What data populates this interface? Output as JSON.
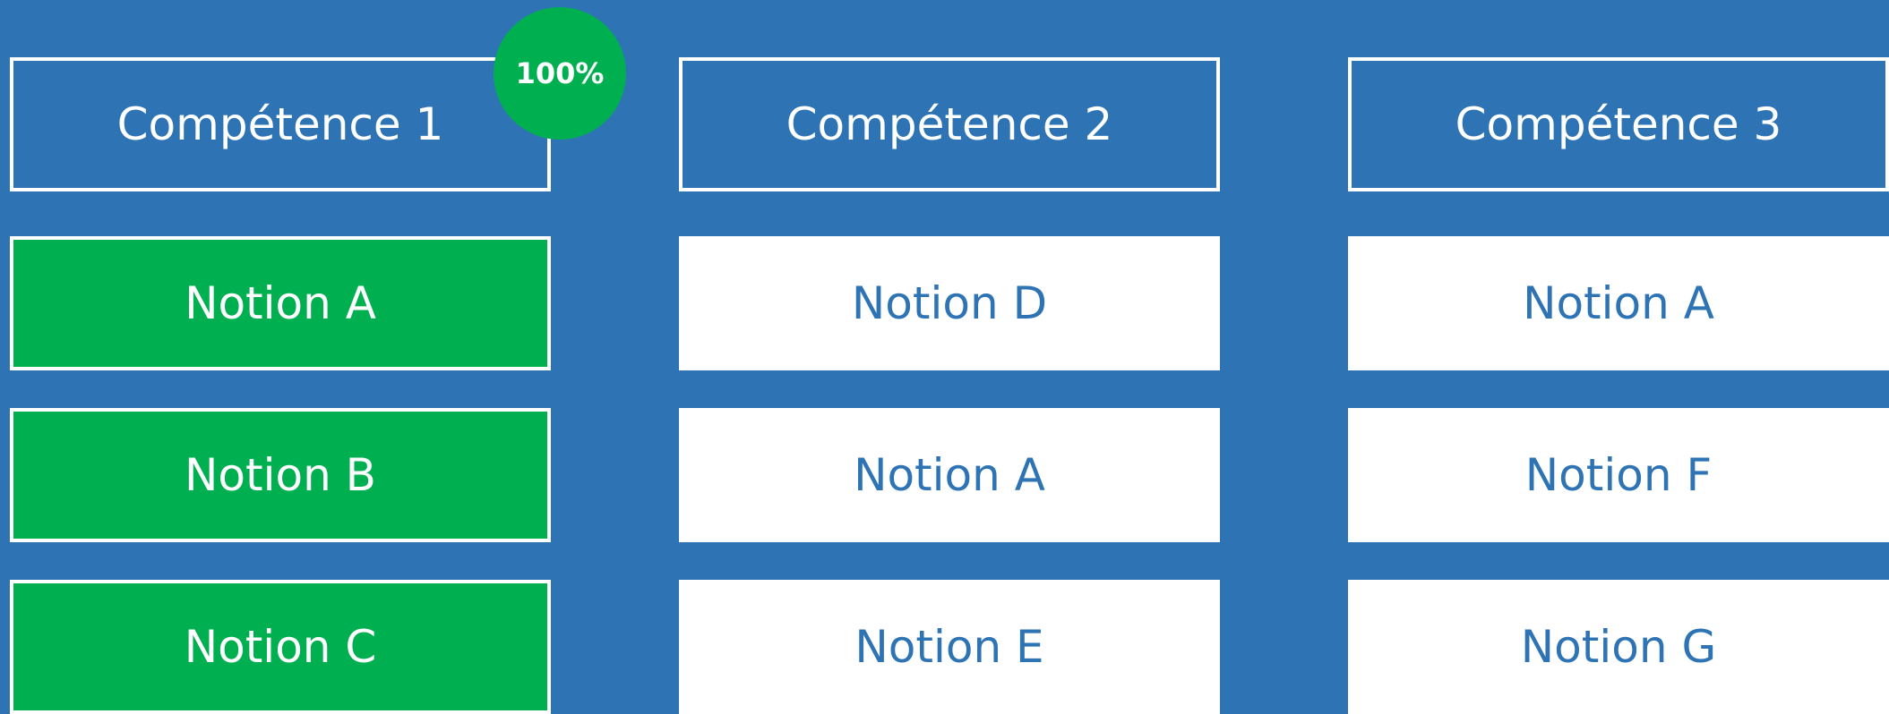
{
  "colors": {
    "background": "#2e74b5",
    "complete": "#00b050",
    "card": "#ffffff",
    "text_on_card": "#2e74b5"
  },
  "columns": [
    {
      "title": "Compétence 1",
      "badge": "100%",
      "notions": [
        {
          "label": "Notion A",
          "status": "done"
        },
        {
          "label": "Notion B",
          "status": "done"
        },
        {
          "label": "Notion C",
          "status": "done"
        }
      ]
    },
    {
      "title": "Compétence 2",
      "notions": [
        {
          "label": "Notion D",
          "status": "todo"
        },
        {
          "label": "Notion A",
          "status": "todo"
        },
        {
          "label": "Notion E",
          "status": "todo"
        }
      ]
    },
    {
      "title": "Compétence 3",
      "notions": [
        {
          "label": "Notion A",
          "status": "todo"
        },
        {
          "label": "Notion F",
          "status": "todo"
        },
        {
          "label": "Notion G",
          "status": "todo"
        }
      ]
    }
  ]
}
